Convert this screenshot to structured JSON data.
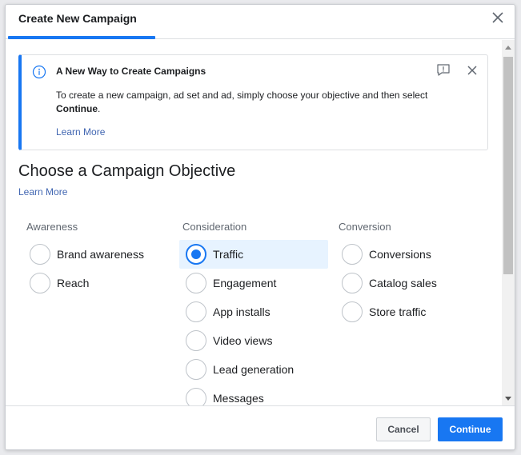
{
  "dialog": {
    "title": "Create New Campaign"
  },
  "notice": {
    "title": "A New Way to Create Campaigns",
    "body_prefix": "To create a new campaign, ad set and ad, simply choose your objective and then select ",
    "body_bold": "Continue",
    "body_suffix": ".",
    "link": "Learn More"
  },
  "objective": {
    "heading": "Choose a Campaign Objective",
    "link": "Learn More",
    "columns": [
      {
        "title": "Awareness",
        "options": [
          "Brand awareness",
          "Reach"
        ]
      },
      {
        "title": "Consideration",
        "options": [
          "Traffic",
          "Engagement",
          "App installs",
          "Video views",
          "Lead generation",
          "Messages"
        ]
      },
      {
        "title": "Conversion",
        "options": [
          "Conversions",
          "Catalog sales",
          "Store traffic"
        ]
      }
    ],
    "selected": "Traffic"
  },
  "footer": {
    "cancel_label": "Cancel",
    "continue_label": "Continue"
  },
  "colors": {
    "accent": "#1877f2",
    "link": "#4267b2",
    "selected_bg": "#e7f3ff"
  },
  "icons": [
    "close-icon",
    "info-icon",
    "feedback-icon"
  ]
}
